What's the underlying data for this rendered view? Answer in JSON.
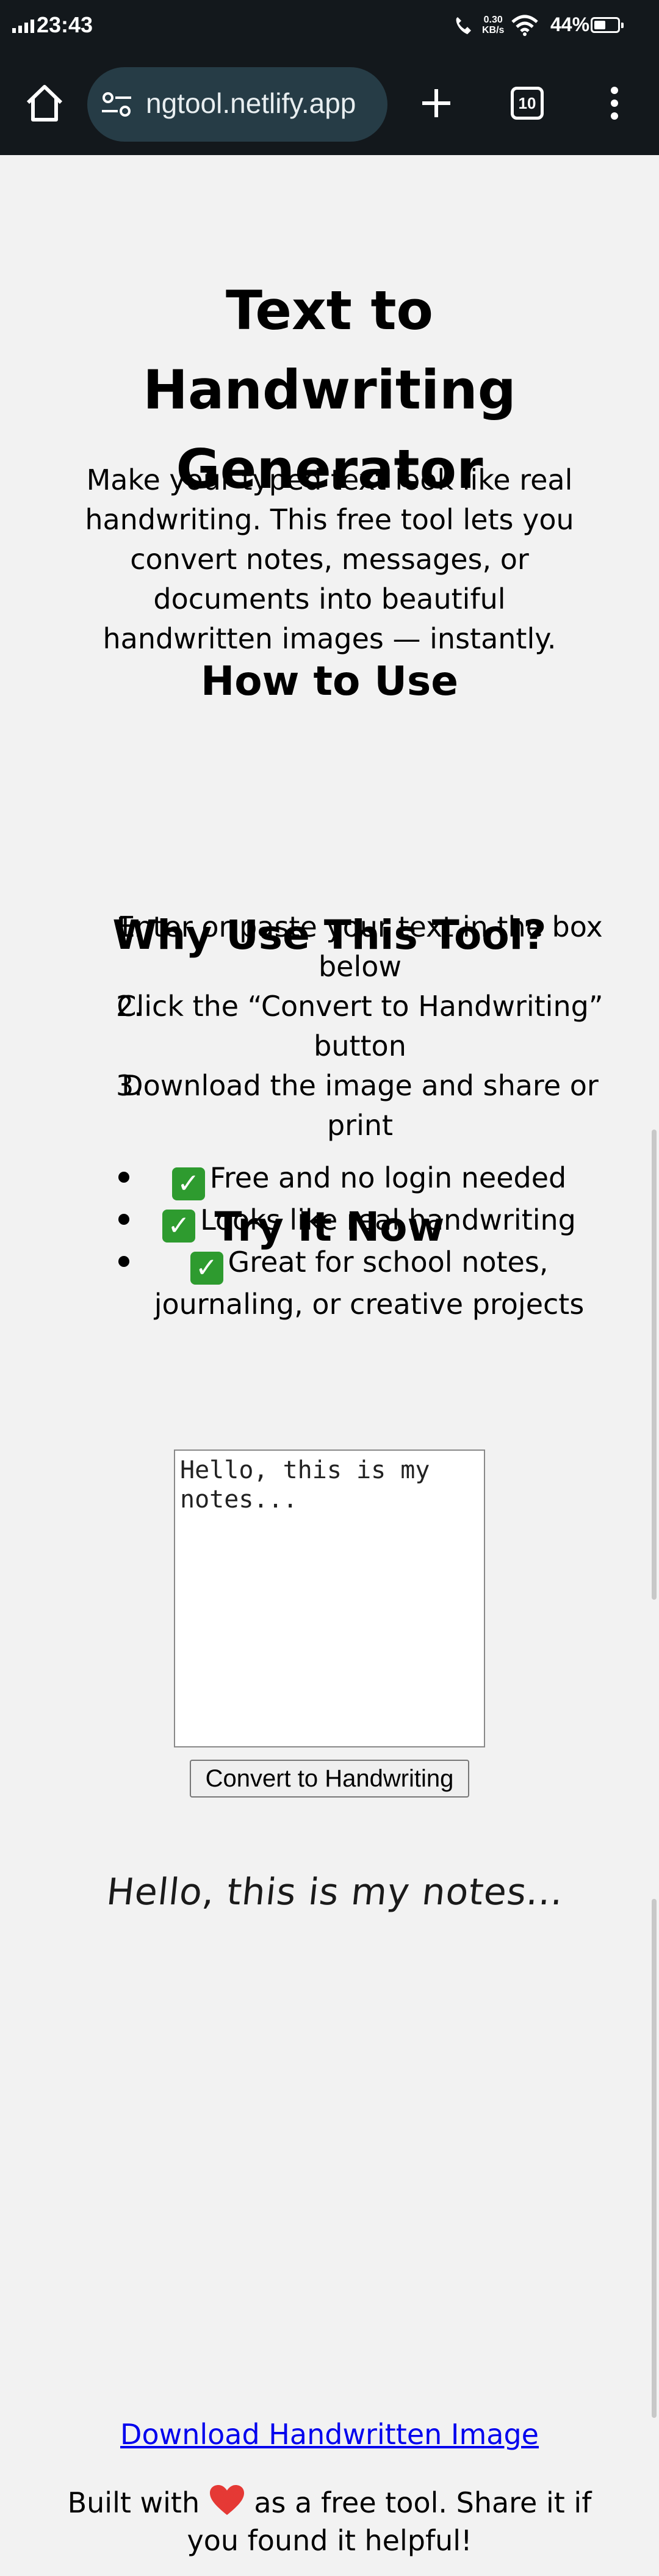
{
  "status_bar": {
    "time": "23:43",
    "net_speed_value": "0.30",
    "net_speed_unit": "KB/s",
    "battery": "44%"
  },
  "browser": {
    "url": "ngtool.netlify.app",
    "tab_count": "10"
  },
  "page": {
    "title": "Text to Handwriting Generator",
    "intro": "Make your typed text look like real handwriting. This free tool lets you convert notes, messages, or documents into beautiful handwritten images — instantly.",
    "how_to_heading": "How to Use",
    "steps": [
      {
        "num": "1.",
        "text": "Enter or paste your text in the box below"
      },
      {
        "num": "2.",
        "text": "Click the “Convert to Handwriting” button"
      },
      {
        "num": "3.",
        "text": "Download the image and share or print"
      }
    ],
    "why_heading": "Why Use This Tool?",
    "benefits": [
      {
        "text": "Free and no login needed"
      },
      {
        "text": "Looks like real handwriting"
      },
      {
        "text": "Great for school notes, journaling, or creative projects"
      }
    ],
    "try_heading": "Try It Now",
    "textarea_value": "Hello, this is my notes...",
    "convert_button": "Convert to Handwriting",
    "output_text": "Hello, this is my notes...",
    "download_link": "Download Handwritten Image",
    "footer_before": "Built with",
    "footer_after": "as a free tool. Share it if you found it helpful!"
  },
  "colors": {
    "status_bg": "#13181c",
    "url_pill": "#263c46",
    "page_bg": "#f2f2f2",
    "link": "#0000ee",
    "check_green": "#2e9b2f",
    "heart_red": "#e53935"
  }
}
